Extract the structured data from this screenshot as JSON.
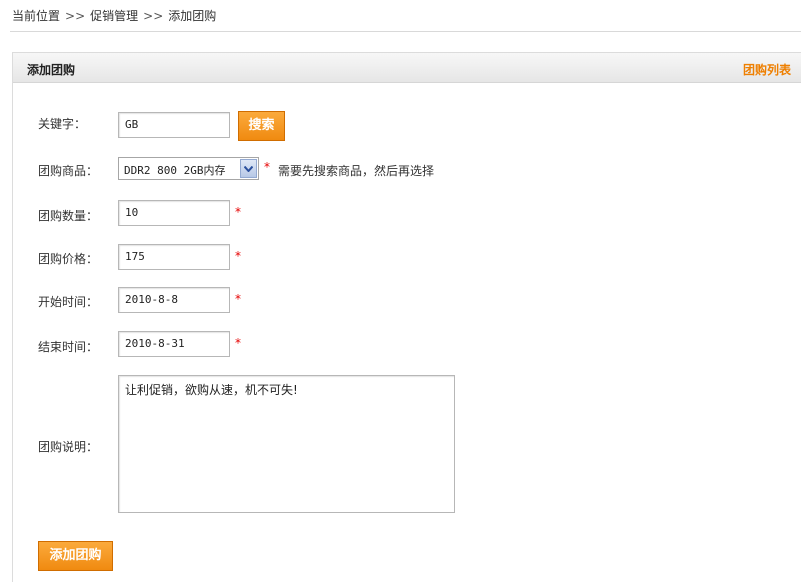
{
  "breadcrumb": {
    "items": [
      "当前位置",
      "促销管理",
      "添加团购"
    ],
    "separator": ">>"
  },
  "panel": {
    "title": "添加团购",
    "list_link": "团购列表"
  },
  "form": {
    "keyword": {
      "label": "关键字：",
      "value": "GB",
      "search_label": "搜索"
    },
    "product": {
      "label": "团购商品：",
      "selected": "DDR2 800 2GB内存",
      "required": "*",
      "hint": "需要先搜索商品，然后再选择"
    },
    "quantity": {
      "label": "团购数量：",
      "value": "10",
      "required": "*"
    },
    "price": {
      "label": "团购价格：",
      "value": "175",
      "required": "*"
    },
    "start": {
      "label": "开始时间：",
      "value": "2010-8-8",
      "required": "*"
    },
    "end": {
      "label": "结束时间：",
      "value": "2010-8-31",
      "required": "*"
    },
    "description": {
      "label": "团购说明：",
      "value": "让利促销，欲购从速，机不可失!"
    },
    "submit_label": "添加团购"
  },
  "colors": {
    "accent": "#ee7f00",
    "required": "#e60000"
  }
}
